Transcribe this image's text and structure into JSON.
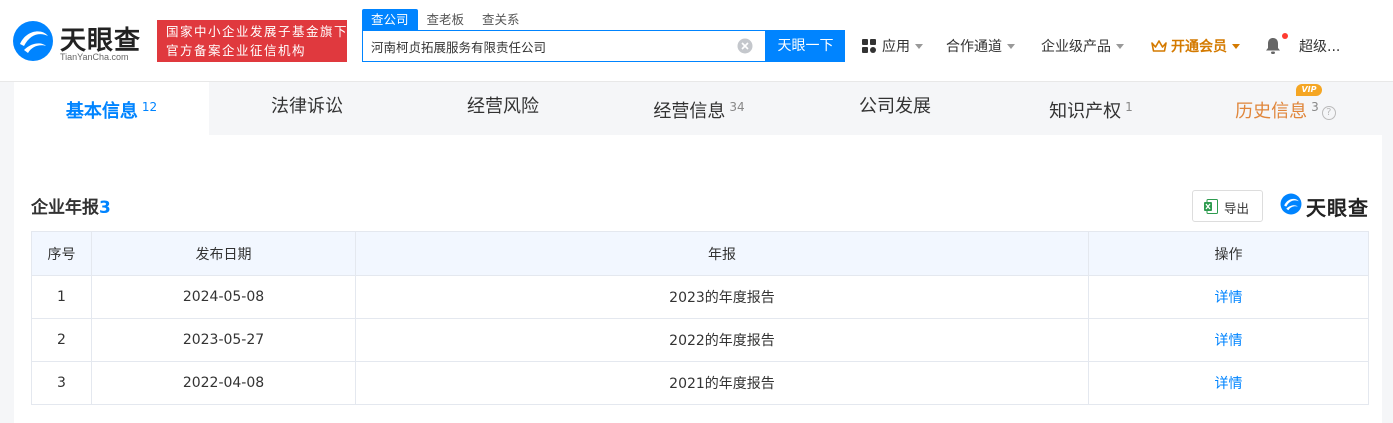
{
  "header": {
    "logo_text": "天眼查",
    "logo_sub": "TianYanCha.com",
    "slogan_line1": "国家中小企业发展子基金旗下",
    "slogan_line2": "官方备案企业征信机构",
    "search_tabs": [
      "查公司",
      "查老板",
      "查关系"
    ],
    "search_value": "河南柯贞拓展服务有限责任公司",
    "search_button": "天眼一下",
    "nav": {
      "apps": "应用",
      "partner": "合作通道",
      "enterprise": "企业级产品",
      "vip": "开通会员",
      "user": "超级..."
    }
  },
  "tabs": [
    {
      "label": "基本信息",
      "count": "12"
    },
    {
      "label": "法律诉讼",
      "count": ""
    },
    {
      "label": "经营风险",
      "count": ""
    },
    {
      "label": "经营信息",
      "count": "34"
    },
    {
      "label": "公司发展",
      "count": ""
    },
    {
      "label": "知识产权",
      "count": "1"
    },
    {
      "label": "历史信息",
      "count": "3",
      "badge": "VIP"
    }
  ],
  "section": {
    "title": "企业年报",
    "count": "3",
    "export_label": "导出",
    "watermark": "天眼查"
  },
  "table": {
    "headers": [
      "序号",
      "发布日期",
      "年报",
      "操作"
    ],
    "rows": [
      {
        "index": "1",
        "date": "2024-05-08",
        "report": "2023的年度报告",
        "action": "详情"
      },
      {
        "index": "2",
        "date": "2023-05-27",
        "report": "2022的年度报告",
        "action": "详情"
      },
      {
        "index": "3",
        "date": "2022-04-08",
        "report": "2021的年度报告",
        "action": "详情"
      }
    ]
  },
  "colors": {
    "brand_blue": "#0084ff",
    "slogan_red": "#e0393e",
    "vip_orange": "#d47a00",
    "history_orange": "#e0863b"
  }
}
